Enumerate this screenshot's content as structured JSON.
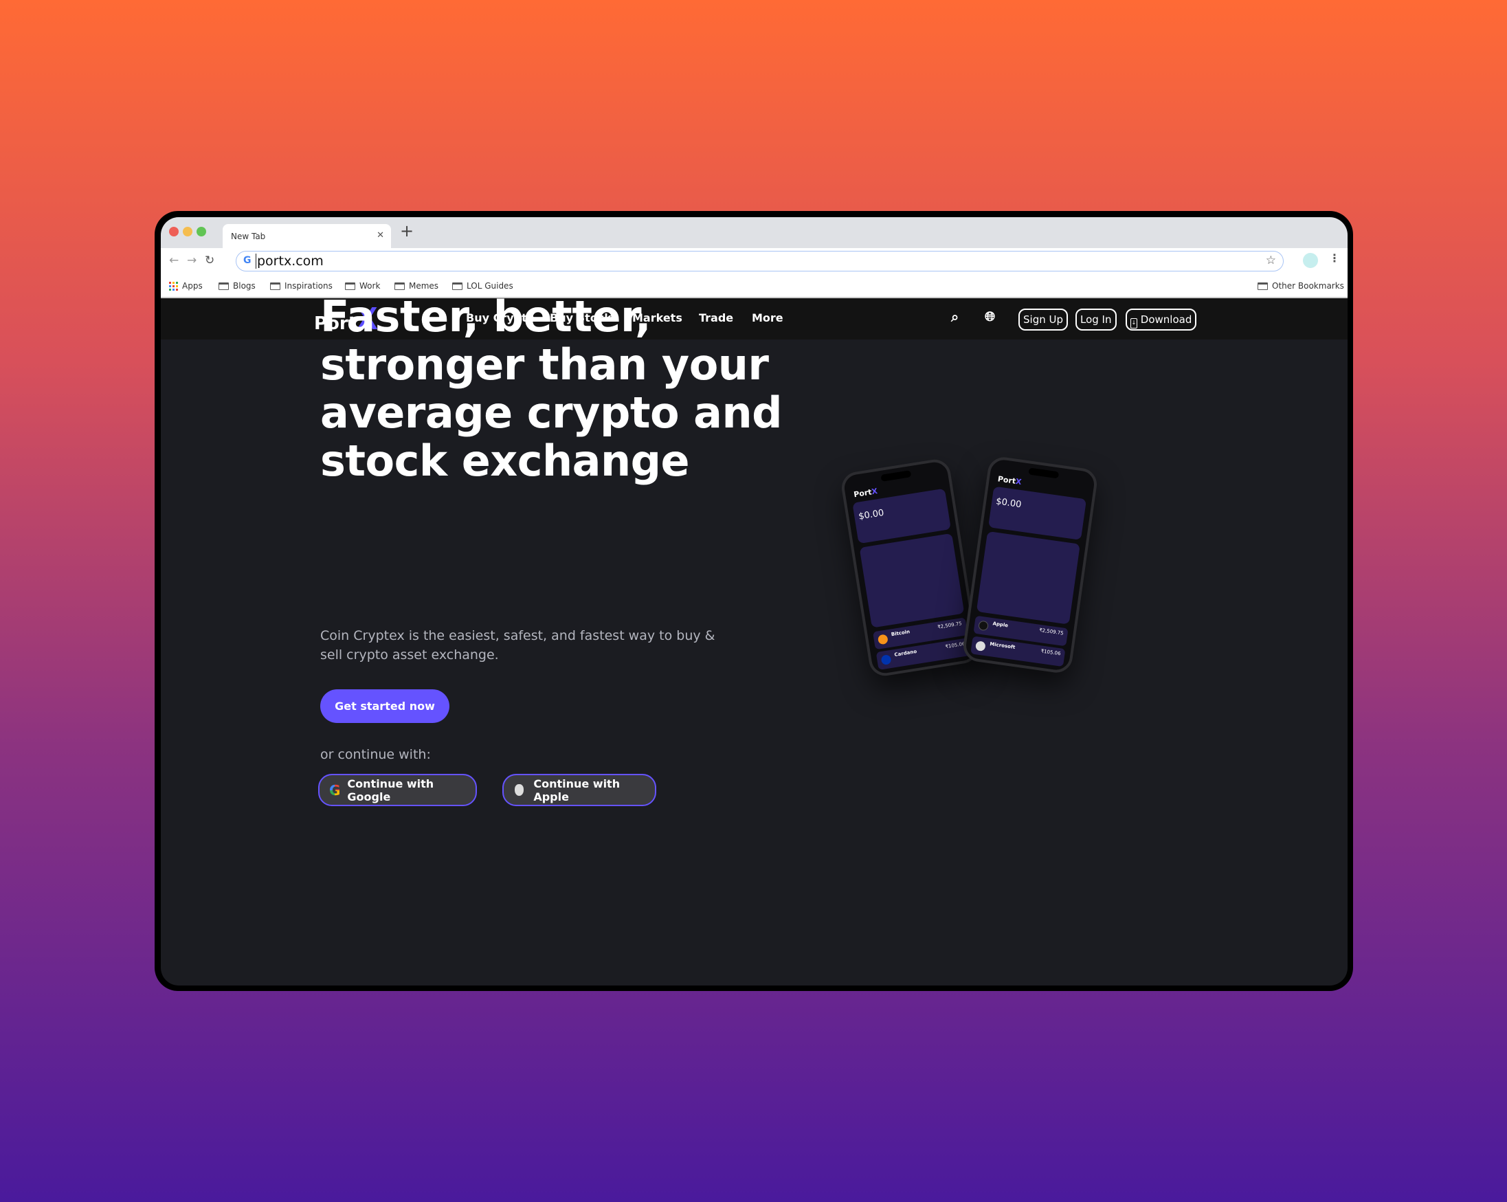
{
  "browser": {
    "tab_title": "New Tab",
    "url": "portx.com",
    "bookmarks": [
      "Apps",
      "Blogs",
      "Inspirations",
      "Work",
      "Memes",
      "LOL Guides"
    ],
    "other_bookmarks": "Other Bookmarks"
  },
  "site": {
    "logo": {
      "text": "Port",
      "mark": "X"
    },
    "nav": [
      "Buy Crypto",
      "Buy Stocks",
      "Markets",
      "Trade",
      "More"
    ],
    "sign_up": "Sign Up",
    "log_in": "Log In",
    "download": "Download",
    "accent": "#6553ff"
  },
  "hero": {
    "title": "Faster, better, stronger than your average crypto and stock exchange",
    "subtitle": "Coin Cryptex is the easiest, safest, and fastest way to buy & sell crypto asset exchange.",
    "cta": "Get started now",
    "or_continue": "or continue with:",
    "google": "Continue with Google",
    "apple": "Continue with Apple"
  },
  "phones": [
    {
      "logo": "Port",
      "mark": "X",
      "balance": "$0.00",
      "rows": [
        {
          "name": "Bitcoin",
          "price": "₹2,509.75",
          "color": "#f7931a"
        },
        {
          "name": "Cardano",
          "price": "₹105.06",
          "color": "#0033ad"
        }
      ]
    },
    {
      "logo": "Port",
      "mark": "X",
      "balance": "$0.00",
      "rows": [
        {
          "name": "Apple",
          "price": "₹2,509.75",
          "color": "#111111"
        },
        {
          "name": "Microsoft",
          "price": "₹105.06",
          "color": "#dddddd"
        }
      ]
    }
  ]
}
